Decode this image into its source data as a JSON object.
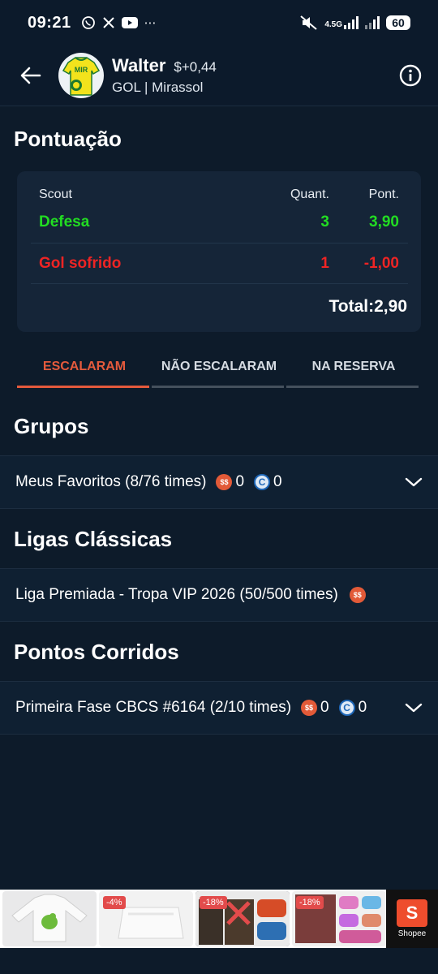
{
  "status_bar": {
    "time": "09:21",
    "left_icons": [
      "whatsapp-icon",
      "x-icon",
      "youtube-icon",
      "more-icon"
    ],
    "network": "4.5G",
    "battery": "60"
  },
  "header": {
    "player_name": "Walter",
    "price_change": "$+0,44",
    "position_team": "GOL | Mirassol",
    "jersey_text": "MIR"
  },
  "pontuacao": {
    "title": "Pontuação",
    "headers": {
      "scout": "Scout",
      "quant": "Quant.",
      "pont": "Pont."
    },
    "rows": [
      {
        "scout": "Defesa",
        "quant": "3",
        "pont": "3,90",
        "color": "#22dd22"
      },
      {
        "scout": "Gol sofrido",
        "quant": "1",
        "pont": "-1,00",
        "color": "#ee2424"
      }
    ],
    "total": "Total:2,90"
  },
  "tabs": [
    {
      "label": "ESCALARAM",
      "active": true
    },
    {
      "label": "NÃO ESCALARAM",
      "active": false
    },
    {
      "label": "NA RESERVA",
      "active": false
    }
  ],
  "sections": {
    "grupos": {
      "title": "Grupos",
      "row": {
        "label": "Meus Favoritos (8/76 times)",
        "coin_red": "0",
        "coin_blue": "0"
      }
    },
    "ligas_classicas": {
      "title": "Ligas Clássicas",
      "row": {
        "label": "Liga Premiada - Tropa VIP 2026 (50/500 times)"
      }
    },
    "pontos_corridos": {
      "title": "Pontos Corridos",
      "row": {
        "label": "Primeira Fase CBCS #6164 (2/10 times)",
        "coin_red": "0",
        "coin_blue": "0"
      }
    }
  },
  "ads": {
    "items": [
      {
        "badge": ""
      },
      {
        "badge": "-4%"
      },
      {
        "badge": "-18%"
      },
      {
        "badge": "-18%"
      }
    ],
    "brand": "Shopee",
    "brand_logo": "S"
  },
  "colors": {
    "background": "#0d1b2a",
    "accent": "#e45a3c",
    "positive": "#22dd22",
    "negative": "#ee2424"
  }
}
